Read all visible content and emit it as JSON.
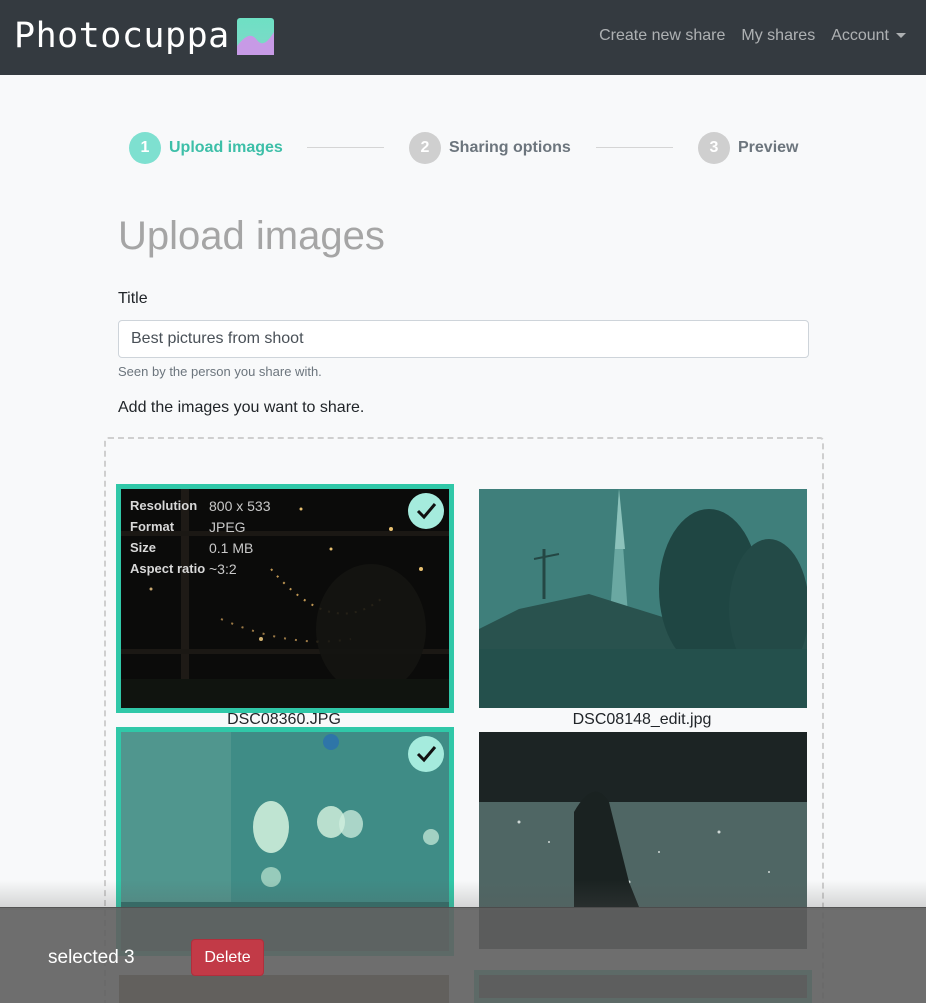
{
  "navbar": {
    "brand": "Photocuppa",
    "links": [
      "Create new share",
      "My shares",
      "Account"
    ],
    "colors": {
      "background": "#343a40"
    }
  },
  "stepper": {
    "steps": [
      {
        "number": "1",
        "label": "Upload images",
        "state": "active"
      },
      {
        "number": "2",
        "label": "Sharing options",
        "state": "inactive"
      },
      {
        "number": "3",
        "label": "Preview",
        "state": "inactive"
      }
    ],
    "colors": {
      "active": "#3dbfa8",
      "inactive": "#6c757d"
    }
  },
  "form": {
    "heading": "Upload images",
    "title_label": "Title",
    "title_value": "Best pictures from shoot",
    "title_help": "Seen by the person you share with.",
    "add_images_text": "Add the images you want to share."
  },
  "images": [
    {
      "filename": "DSC08360.JPG",
      "selected": true,
      "info": [
        {
          "key": "Resolution",
          "value": "800 x 533"
        },
        {
          "key": "Format",
          "value": "JPEG"
        },
        {
          "key": "Size",
          "value": "0.1 MB"
        },
        {
          "key": "Aspect ratio",
          "value": "~3:2"
        }
      ]
    },
    {
      "filename": "DSC08148_edit.jpg",
      "selected": false
    },
    {
      "filename": "",
      "selected": true
    },
    {
      "filename": "",
      "selected": false
    }
  ],
  "selection_bar": {
    "count_text": "selected 3",
    "delete_label": "Delete",
    "colors": {
      "delete": "#c23a47",
      "selected_border": "#30c8a8"
    }
  }
}
